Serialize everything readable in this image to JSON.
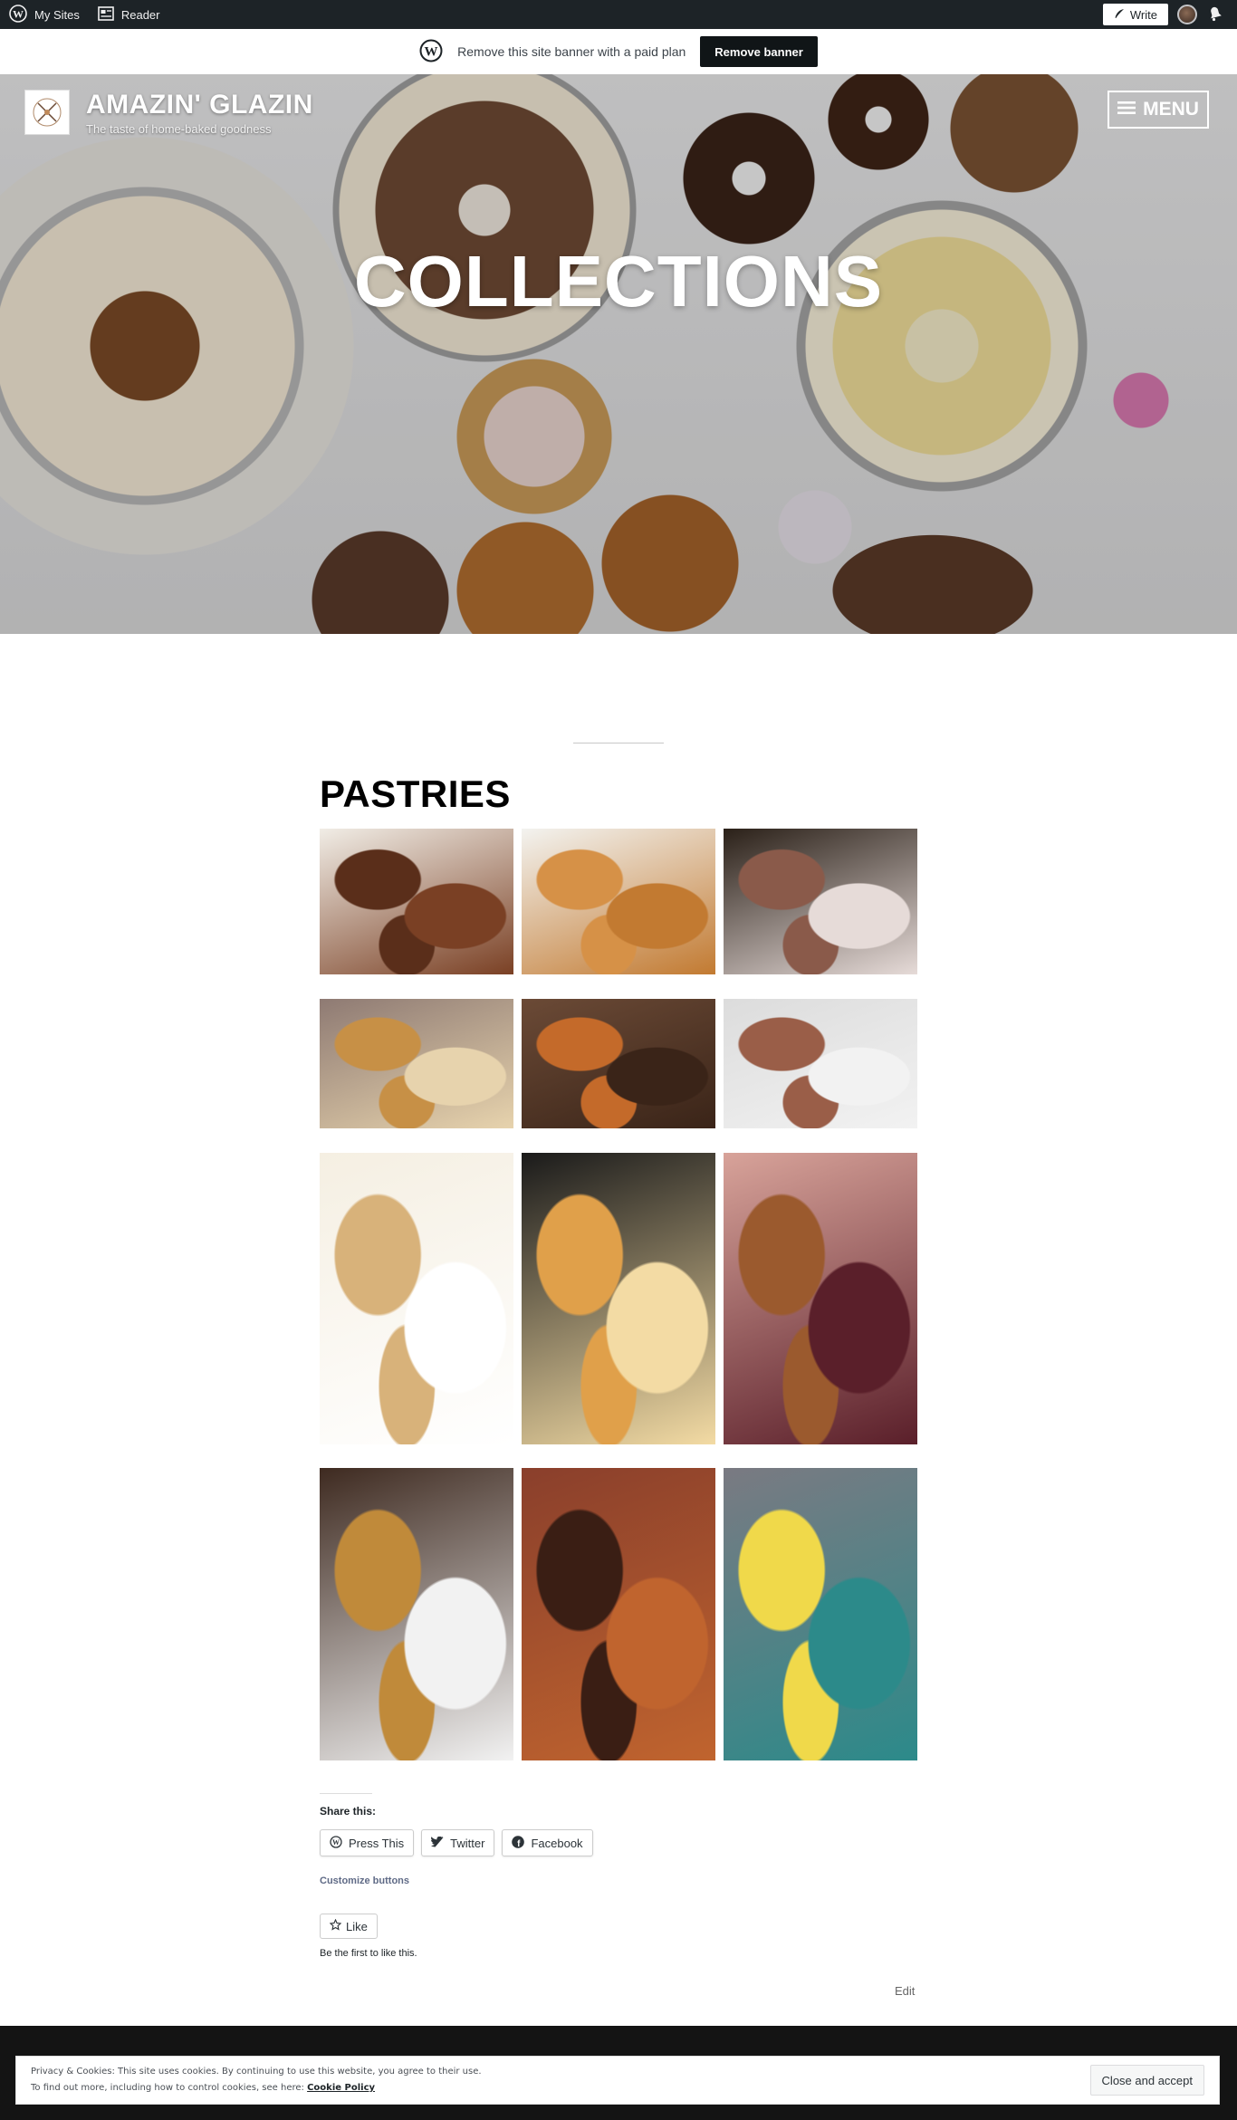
{
  "admin_bar": {
    "my_sites": "My Sites",
    "reader": "Reader",
    "write": "Write"
  },
  "site_banner": {
    "text": "Remove this site banner with a paid plan",
    "button": "Remove banner"
  },
  "site": {
    "title": "AMAZIN' GLAZIN",
    "tagline": "The taste of home-baked goodness",
    "menu_label": "MENU"
  },
  "hero": {
    "title": "COLLECTIONS"
  },
  "main": {
    "heading": "PASTRIES",
    "gallery": [
      {
        "name": "brownies",
        "colors": [
          "#f1ede6",
          "#5a2e1a",
          "#7a4024"
        ]
      },
      {
        "name": "floss-bread",
        "colors": [
          "#f3f3f0",
          "#d69147",
          "#c27a31"
        ]
      },
      {
        "name": "donuts-box",
        "colors": [
          "#2a2018",
          "#8a5a4a",
          "#e6dbd8"
        ]
      },
      {
        "name": "loaf-cake",
        "colors": [
          "#8e7a73",
          "#c79046",
          "#e7d3ad"
        ]
      },
      {
        "name": "croissants",
        "colors": [
          "#6b4a36",
          "#c46a2a",
          "#3a2418"
        ]
      },
      {
        "name": "chocolate-macarons",
        "colors": [
          "#dcdcdc",
          "#9a5e48",
          "#f2f2f2"
        ]
      },
      {
        "name": "cinnamon-rolls",
        "colors": [
          "#f5efe2",
          "#d8b27a",
          "#ffffff"
        ]
      },
      {
        "name": "custard-bars",
        "colors": [
          "#1a1a1a",
          "#e0a04a",
          "#f3dba4"
        ]
      },
      {
        "name": "lattice-pie",
        "colors": [
          "#d8a39a",
          "#9b5a2e",
          "#5a1f2a"
        ]
      },
      {
        "name": "chocolate-chip-bars",
        "colors": [
          "#3e2a20",
          "#c08a3a",
          "#f2f2f2"
        ]
      },
      {
        "name": "eclairs",
        "colors": [
          "#8a3f2c",
          "#3a1e14",
          "#c0642e"
        ]
      },
      {
        "name": "lemon-cake",
        "colors": [
          "#7a7a82",
          "#f0d94a",
          "#2c8a8a"
        ]
      }
    ]
  },
  "share": {
    "title": "Share this:",
    "buttons": [
      "Press This",
      "Twitter",
      "Facebook"
    ],
    "customize": "Customize buttons"
  },
  "like": {
    "button": "Like",
    "note": "Be the first to like this."
  },
  "edit_link": "Edit",
  "cookie": {
    "line1": "Privacy & Cookies: This site uses cookies. By continuing to use this website, you agree to their use.",
    "line2": "To find out more, including how to control cookies, see here:",
    "link": "Cookie Policy",
    "button": "Close and accept"
  }
}
